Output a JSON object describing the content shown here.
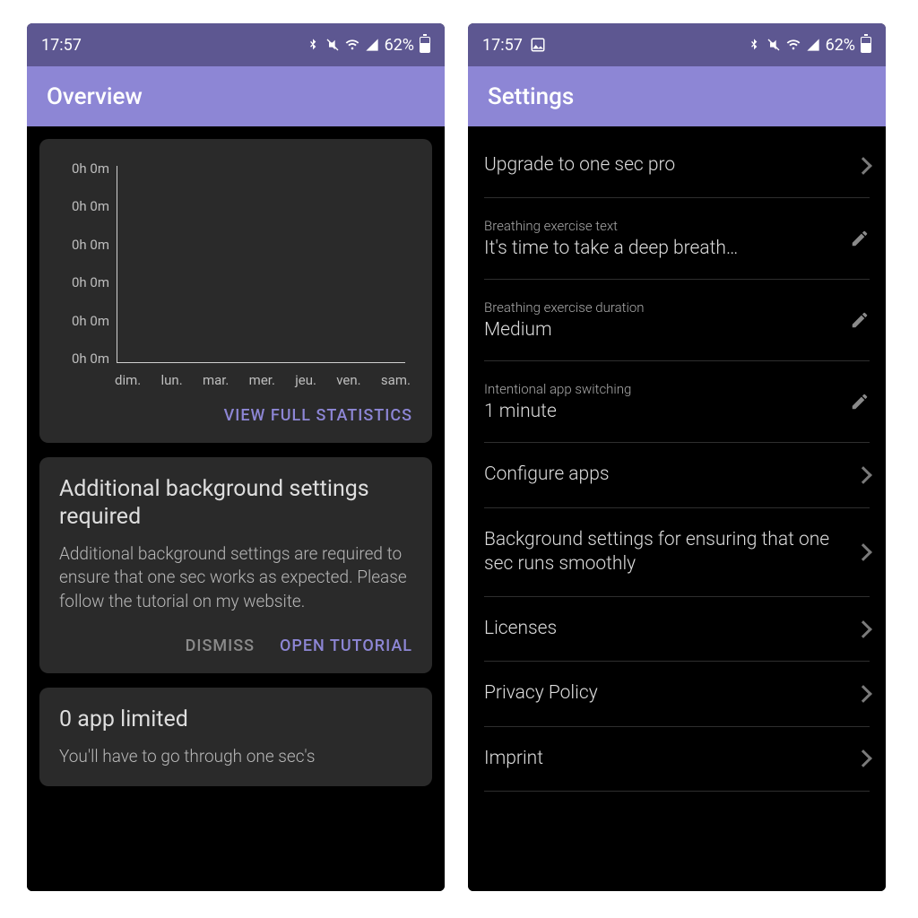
{
  "left": {
    "status": {
      "time": "17:57",
      "battery": "62%"
    },
    "header": {
      "title": "Overview"
    },
    "chart_action": "VIEW FULL STATISTICS",
    "bg_card": {
      "title": "Additional background settings required",
      "body": "Additional background settings are required to ensure that one sec works as expected. Please follow the tutorial on my website.",
      "dismiss": "DISMISS",
      "open": "OPEN TUTORIAL"
    },
    "limited_card": {
      "title": "0 app limited",
      "body": "You'll have to go through one sec's"
    }
  },
  "right": {
    "status": {
      "time": "17:57",
      "battery": "62%"
    },
    "header": {
      "title": "Settings"
    },
    "items": {
      "upgrade": "Upgrade to one sec pro",
      "breath_text_label": "Breathing exercise text",
      "breath_text_value": "It's time to take a deep breath…",
      "breath_dur_label": "Breathing exercise duration",
      "breath_dur_value": "Medium",
      "switch_label": "Intentional app switching",
      "switch_value": "1 minute",
      "configure": "Configure apps",
      "background": "Background settings for ensuring that one sec runs smoothly",
      "licenses": "Licenses",
      "privacy": "Privacy Policy",
      "imprint": "Imprint"
    }
  },
  "chart_data": {
    "type": "bar",
    "categories": [
      "dim.",
      "lun.",
      "mar.",
      "mer.",
      "jeu.",
      "ven.",
      "sam."
    ],
    "values": [
      0,
      0,
      0,
      0,
      0,
      0,
      0
    ],
    "y_ticks": [
      "0h 0m",
      "0h 0m",
      "0h 0m",
      "0h 0m",
      "0h 0m",
      "0h 0m"
    ],
    "title": "",
    "xlabel": "",
    "ylabel": "",
    "ylim": [
      0,
      0
    ]
  }
}
